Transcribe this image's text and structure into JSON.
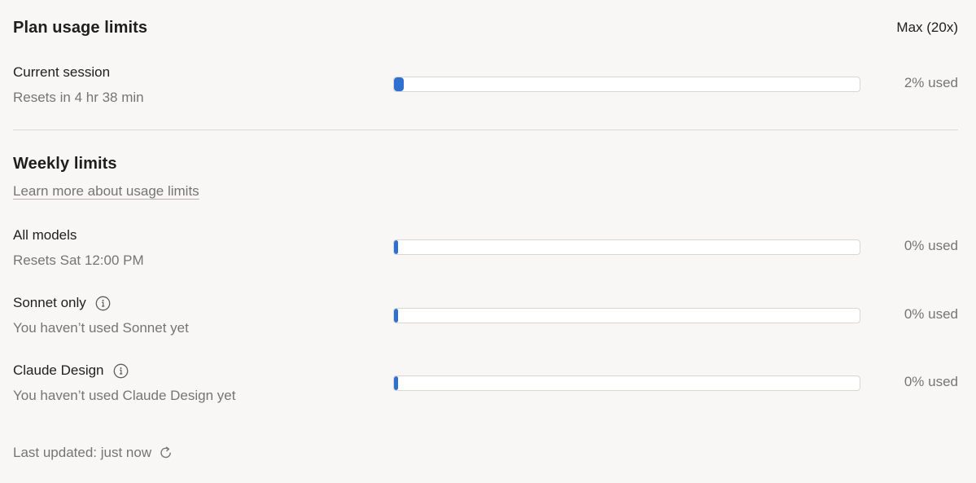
{
  "plan": {
    "title": "Plan usage limits",
    "plan_name": "Max (20x)"
  },
  "current_session": {
    "label": "Current session",
    "subtext": "Resets in 4 hr 38 min",
    "percent_text": "2% used",
    "percent": 2
  },
  "weekly": {
    "title": "Weekly limits",
    "learn_more_link": "Learn more about usage limits",
    "items": [
      {
        "label": "All models",
        "subtext": "Resets Sat 12:00 PM",
        "percent_text": "0% used",
        "percent": 0,
        "has_info_icon": false
      },
      {
        "label": "Sonnet only",
        "subtext": "You haven’t used Sonnet yet",
        "percent_text": "0% used",
        "percent": 0,
        "has_info_icon": true
      },
      {
        "label": "Claude Design",
        "subtext": "You haven’t used Claude Design yet",
        "percent_text": "0% used",
        "percent": 0,
        "has_info_icon": true
      }
    ]
  },
  "footer": {
    "last_updated": "Last updated: just now"
  },
  "icons": {
    "info": "info-icon",
    "refresh": "refresh-icon"
  },
  "colors": {
    "bar_fill": "#2f6fd0",
    "background": "#f8f7f5",
    "muted_text": "#767571"
  }
}
